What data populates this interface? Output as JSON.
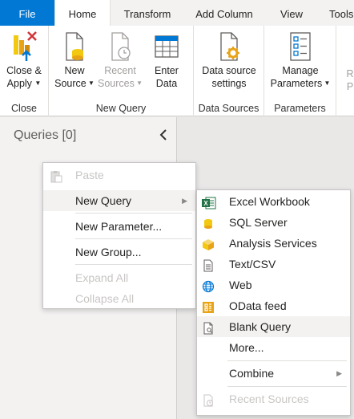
{
  "tabs": [
    {
      "label": "File"
    },
    {
      "label": "Home"
    },
    {
      "label": "Transform"
    },
    {
      "label": "Add Column"
    },
    {
      "label": "View"
    },
    {
      "label": "Tools"
    }
  ],
  "ribbon": {
    "close": {
      "btn_line1": "Close &",
      "btn_line2": "Apply",
      "group": "Close"
    },
    "new_query": {
      "new_source_1": "New",
      "new_source_2": "Source",
      "recent_sources_1": "Recent",
      "recent_sources_2": "Sources",
      "enter_data_1": "Enter",
      "enter_data_2": "Data",
      "group": "New Query"
    },
    "data_sources": {
      "btn_line1": "Data source",
      "btn_line2": "settings",
      "group": "Data Sources"
    },
    "parameters": {
      "btn_line1": "Manage",
      "btn_line2": "Parameters",
      "group": "Parameters"
    },
    "refresh_partial_1": "R",
    "refresh_partial_2": "P"
  },
  "queries_pane": {
    "title": "Queries [0]"
  },
  "context_menu": {
    "paste": "Paste",
    "new_query": "New Query",
    "new_parameter": "New Parameter...",
    "new_group": "New Group...",
    "expand_all": "Expand All",
    "collapse_all": "Collapse All"
  },
  "submenu": {
    "excel": "Excel Workbook",
    "sql": "SQL Server",
    "analysis": "Analysis Services",
    "textcsv": "Text/CSV",
    "web": "Web",
    "odata": "OData feed",
    "blank": "Blank Query",
    "more": "More...",
    "combine": "Combine",
    "recent": "Recent Sources"
  },
  "colors": {
    "accent": "#0078d4",
    "excel_green": "#217346",
    "orange": "#e8a317"
  }
}
